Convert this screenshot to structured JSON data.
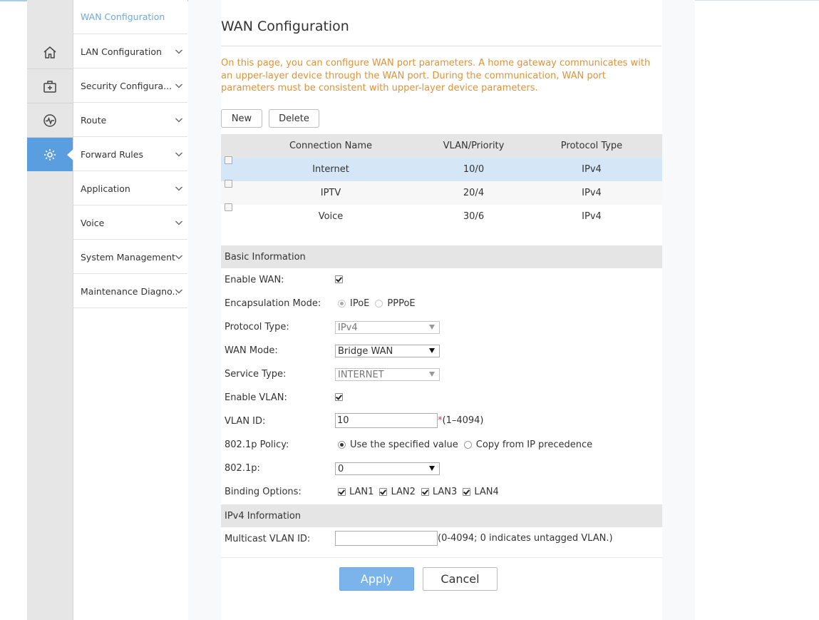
{
  "nav": {
    "rail": [
      {
        "icon": "home-icon"
      },
      {
        "icon": "toolbox-icon"
      },
      {
        "icon": "status-icon"
      },
      {
        "icon": "gear-icon",
        "active": true
      }
    ],
    "menu": [
      {
        "label": "WAN Configuration",
        "active": true
      },
      {
        "label": "LAN Configuration"
      },
      {
        "label": "Security Configura..."
      },
      {
        "label": "Route"
      },
      {
        "label": "Forward Rules"
      },
      {
        "label": "Application"
      },
      {
        "label": "Voice"
      },
      {
        "label": "System Management"
      },
      {
        "label": "Maintenance Diagno.."
      }
    ]
  },
  "page": {
    "title": "WAN Configuration",
    "intro": "On this page, you can configure WAN port parameters. A home gateway communicates with an upper-layer device through the WAN port. During the communication, WAN port parameters must be consistent with upper-layer device parameters."
  },
  "toolbar": {
    "new_label": "New",
    "delete_label": "Delete"
  },
  "table": {
    "headers": [
      "",
      "Connection Name",
      "VLAN/Priority",
      "Protocol Type"
    ],
    "rows": [
      {
        "name": "Internet",
        "vlan": "10/0",
        "protocol": "IPv4",
        "selected": true
      },
      {
        "name": "IPTV",
        "vlan": "20/4",
        "protocol": "IPv4",
        "selected": false
      },
      {
        "name": "Voice",
        "vlan": "30/6",
        "protocol": "IPv4",
        "selected": false
      }
    ]
  },
  "basic": {
    "section_title": "Basic Information",
    "enable_wan_label": "Enable WAN:",
    "enable_wan": true,
    "encap_label": "Encapsulation Mode:",
    "encap_options": [
      "IPoE",
      "PPPoE"
    ],
    "encap_selected": "IPoE",
    "protocol_label": "Protocol Type:",
    "protocol_value": "IPv4",
    "wan_mode_label": "WAN Mode:",
    "wan_mode_value": "Bridge WAN",
    "service_label": "Service Type:",
    "service_value": "INTERNET",
    "enable_vlan_label": "Enable VLAN:",
    "enable_vlan": true,
    "vlan_id_label": "VLAN ID:",
    "vlan_id_value": "10",
    "vlan_id_required": "*",
    "vlan_id_hint": "(1–4094)",
    "policy_label": "802.1p Policy:",
    "policy_options": [
      "Use the specified value",
      "Copy from IP precedence"
    ],
    "policy_selected": "Use the specified value",
    "p8021_label": "802.1p:",
    "p8021_value": "0",
    "binding_label": "Binding Options:",
    "binding": [
      {
        "label": "LAN1",
        "checked": true
      },
      {
        "label": "LAN2",
        "checked": true
      },
      {
        "label": "LAN3",
        "checked": true
      },
      {
        "label": "LAN4",
        "checked": true
      }
    ]
  },
  "ipv4": {
    "section_title": "IPv4 Information",
    "mcast_label": "Multicast VLAN ID:",
    "mcast_value": "",
    "mcast_hint": "(0-4094; 0 indicates untagged VLAN.)"
  },
  "actions": {
    "apply_label": "Apply",
    "cancel_label": "Cancel"
  },
  "colors": {
    "accent": "#5a9ee0",
    "intro_text": "#e0923a",
    "selected_row": "#d5e7f7",
    "apply_button": "#7bb4ea"
  }
}
